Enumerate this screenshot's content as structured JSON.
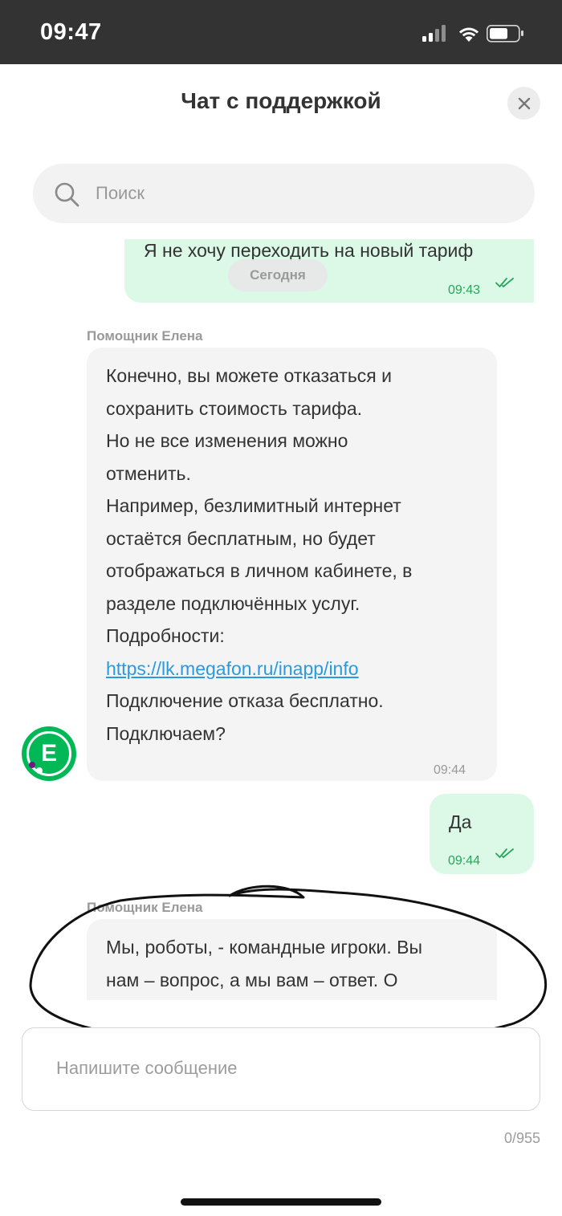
{
  "status_bar": {
    "time": "09:47",
    "icons": [
      "signal-icon",
      "wifi-icon",
      "battery-icon"
    ]
  },
  "header": {
    "title": "Чат с поддержкой",
    "close_icon": "close-icon"
  },
  "search": {
    "placeholder": "Поиск",
    "icon": "search-icon"
  },
  "chat": {
    "date_separator": "Сегодня",
    "messages": [
      {
        "direction": "outgoing",
        "text": "Я не хочу переходить на новый тариф",
        "time": "09:43",
        "read": true
      },
      {
        "direction": "incoming",
        "sender": "Помощник Елена",
        "lines": [
          "Конечно, вы можете отказаться и",
          "сохранить стоимость тарифа.",
          "Но не все изменения можно",
          "отменить.",
          "Например, безлимитный интернет",
          "остаётся бесплатным, но будет",
          "отображаться в личном кабинете, в",
          "разделе подключённых услуг.",
          "Подробности:"
        ],
        "link": "https://lk.megafon.ru/inapp/info",
        "lines_after": [
          "Подключение отказа бесплатно.",
          "Подключаем?"
        ],
        "time": "09:44",
        "avatar_letter": "E"
      },
      {
        "direction": "outgoing",
        "text": "Да",
        "time": "09:44",
        "read": true
      },
      {
        "direction": "incoming",
        "sender": "Помощник Елена",
        "lines": [
          "Мы, роботы, - командные игроки. Вы",
          "нам – вопрос, а мы вам – ответ. О"
        ]
      }
    ]
  },
  "composer": {
    "placeholder": "Напишите сообщение",
    "counter": "0/955"
  },
  "colors": {
    "accent_green": "#00b956",
    "outgoing_bubble": "#dbf9e6",
    "incoming_bubble": "#f4f4f4",
    "link": "#2a9ae0",
    "status_bar": "#333333"
  }
}
